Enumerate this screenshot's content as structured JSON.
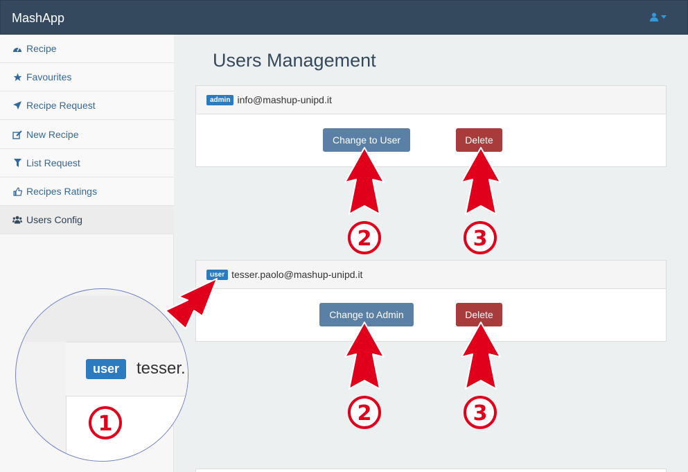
{
  "app": {
    "title": "MashApp"
  },
  "header": {
    "user_menu_icon": "user-icon",
    "caret_icon": "caret-down-icon"
  },
  "sidebar": {
    "items": [
      {
        "label": "Recipe",
        "icon": "dashboard-icon"
      },
      {
        "label": "Favourites",
        "icon": "star-icon"
      },
      {
        "label": "Recipe Request",
        "icon": "send-icon"
      },
      {
        "label": "New Recipe",
        "icon": "edit-icon"
      },
      {
        "label": "List Request",
        "icon": "filter-icon"
      },
      {
        "label": "Recipes Ratings",
        "icon": "thumbs-up-icon"
      },
      {
        "label": "Users Config",
        "icon": "users-icon"
      }
    ],
    "active": "Users Config"
  },
  "main": {
    "title": "Users Management",
    "users": [
      {
        "role": "admin",
        "email": "info@mashup-unipd.it",
        "change_label": "Change to User",
        "delete_label": "Delete"
      },
      {
        "role": "user",
        "email": "tesser.paolo@mashup-unipd.it",
        "change_label": "Change to Admin",
        "delete_label": "Delete"
      }
    ]
  },
  "annotations": {
    "zoom_label": "user",
    "zoom_text": "tesser.",
    "markers": [
      "1",
      "2",
      "3",
      "2",
      "3"
    ],
    "arrow_color": "#e0001b"
  },
  "colors": {
    "navbar": "#34495e",
    "primary_button": "#5b80a6",
    "danger_button": "#a83b3b",
    "label": "#2c7bc0"
  }
}
